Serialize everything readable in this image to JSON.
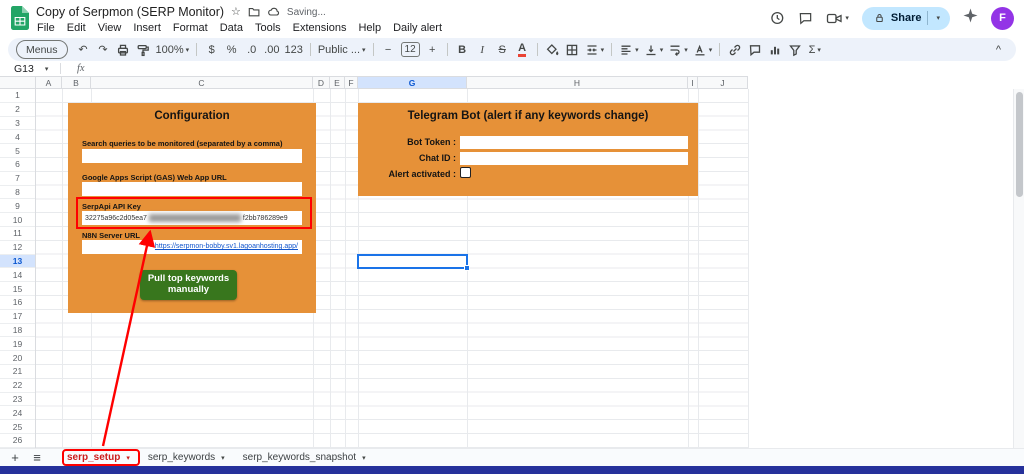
{
  "titlebar": {
    "title": "Copy of Serpmon (SERP Monitor)",
    "saving": "Saving...",
    "menus": [
      "File",
      "Edit",
      "View",
      "Insert",
      "Format",
      "Data",
      "Tools",
      "Extensions",
      "Help",
      "Daily alert"
    ],
    "share_label": "Share",
    "avatar_initial": "F"
  },
  "icons": {
    "chevron_down": "▾",
    "undo": "↶",
    "redo": "↷",
    "star": "☆",
    "sigma": "Σ",
    "hamburger": "≡",
    "plus": "+",
    "minus": "−",
    "plus_small": "+",
    "collapse": "^"
  },
  "toolbar": {
    "menus_label": "Menus",
    "zoom": "100%",
    "currency": "$",
    "percent": "%",
    "decrease_decimal": ".0",
    "increase_decimal": ".00",
    "number_format": "123",
    "font": "Public ...",
    "font_size": "12",
    "bold": "B",
    "italic": "I",
    "strikethrough": "S",
    "text_color": "A"
  },
  "formula": {
    "name_box": "G13",
    "fx": "fx"
  },
  "grid": {
    "columns": [
      "A",
      "B",
      "C",
      "D",
      "E",
      "F",
      "G",
      "H",
      "I",
      "J"
    ],
    "selected_column": "G",
    "rows": [
      "1",
      "2",
      "3",
      "4",
      "5",
      "6",
      "7",
      "8",
      "9",
      "10",
      "11",
      "12",
      "13",
      "14",
      "15",
      "16",
      "17",
      "18",
      "19",
      "20",
      "21",
      "22",
      "23",
      "24",
      "25",
      "26"
    ],
    "selected_row": "13",
    "selected_cell": "G13"
  },
  "config_box": {
    "title": "Configuration",
    "queries_label": "Search queries to be monitored (separated by a comma)",
    "gas_label": "Google Apps Script (GAS) Web App URL",
    "serpapi_label": "SerpApi API Key",
    "api_key_visible_prefix": "32275a96c2d05ea7",
    "api_key_visible_suffix": "f2bb786289e9",
    "n8n_label": "N8N Server URL",
    "n8n_url": "https://serpmon-bobby.sv1.lagoanhosting.app/",
    "button_label": "Pull top keywords manually"
  },
  "telegram_box": {
    "title": "Telegram Bot (alert if any keywords change)",
    "bot_token_label": "Bot Token :",
    "chat_id_label": "Chat ID :",
    "alert_label": "Alert activated :",
    "alert_checked": false
  },
  "tabs": {
    "items": [
      "serp_setup",
      "serp_keywords",
      "serp_keywords_snapshot"
    ],
    "active": "serp_setup"
  },
  "colors": {
    "box_orange": "#e69138",
    "button_green": "#38761d",
    "annotation_red": "#ff0000",
    "link_blue": "#1155cc",
    "selection_blue": "#1a73e8",
    "share_pill": "#c2e7ff"
  }
}
